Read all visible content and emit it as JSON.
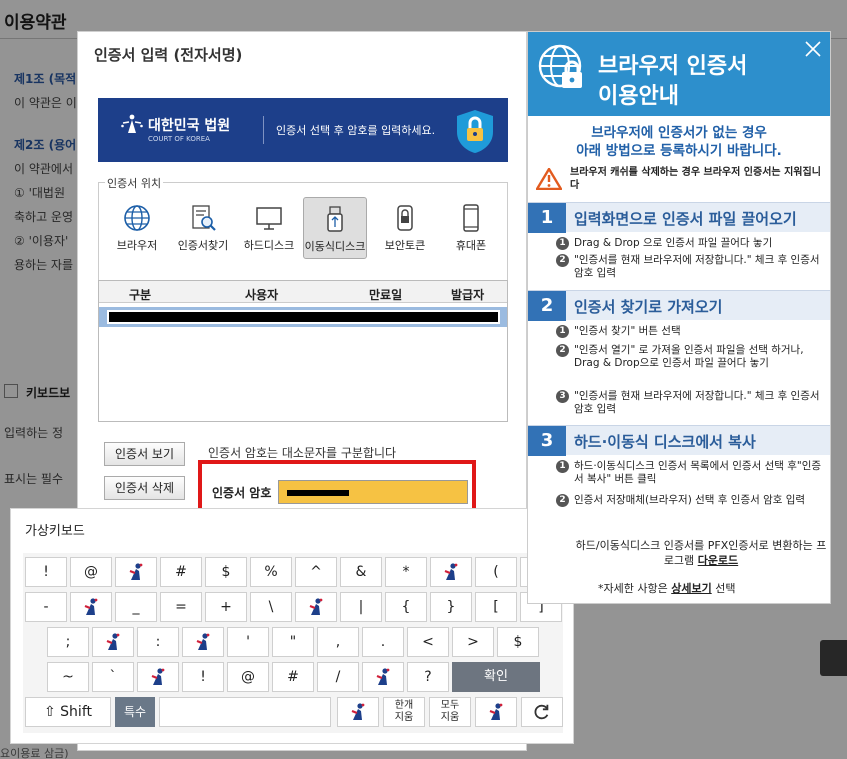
{
  "background": {
    "page_title": "이용약관",
    "line1": "제1조 (목적",
    "line2": "이 약관은 이",
    "line3": "제2조 (용어",
    "line4": "이 약관에서",
    "line5": "① '대법원",
    "line6": "축하고 운영",
    "line7": "② '이용자'",
    "line8": "용하는 자를",
    "keyboard_label": "키보드보",
    "line9": "입력하는 정",
    "line10": "표시는 필수",
    "footer": "요이용료 삼금)"
  },
  "cert_dialog": {
    "title": "인증서 입력 (전자서명)",
    "banner": {
      "court_name": "대한민국 법원",
      "court_en": "COURT OF KOREA",
      "message": "인증서 선택 후 암호를 입력하세요."
    },
    "location_legend": "인증서 위치",
    "locations": [
      {
        "label": "브라우저",
        "icon": "globe-icon"
      },
      {
        "label": "인증서찾기",
        "icon": "cert-search-icon"
      },
      {
        "label": "하드디스크",
        "icon": "monitor-icon"
      },
      {
        "label": "이동식디스크",
        "icon": "usb-icon"
      },
      {
        "label": "보안토큰",
        "icon": "token-icon"
      },
      {
        "label": "휴대폰",
        "icon": "phone-icon"
      }
    ],
    "table_headers": [
      "구분",
      "사용자",
      "만료일",
      "발급자"
    ],
    "view_button": "인증서 보기",
    "delete_button": "인증서 삭제",
    "case_note": "인증서 암호는 대소문자를 구분합니다",
    "password_label": "인증서 암호"
  },
  "keyboard": {
    "title": "가상키보드",
    "row1": [
      "!",
      "@",
      "",
      "#",
      "$",
      "%",
      "^",
      "&",
      "*",
      "",
      "(",
      ")"
    ],
    "row2": [
      "-",
      "",
      "_",
      "=",
      "+",
      "\\",
      "",
      "|",
      "{",
      "}",
      "[",
      "]"
    ],
    "row3": [
      ";",
      "",
      ":",
      "",
      "'",
      "\"",
      ",",
      ".",
      "<",
      ">",
      "$"
    ],
    "row4": [
      "~",
      "`",
      "",
      "!",
      "@",
      "#",
      "/",
      "",
      "?"
    ],
    "confirm": "확인",
    "shift": "⇧ Shift",
    "special": "특수",
    "clear_one_1": "한개",
    "clear_one_2": "지움",
    "clear_all_1": "모두",
    "clear_all_2": "지움"
  },
  "guide": {
    "title_line1": "브라우저 인증서",
    "title_line2": "이용안내",
    "intro_line1": "브라우저에 인증서가 없는 경우",
    "intro_line2": "아래 방법으로 등록하시기 바랍니다.",
    "warning": "브라우저 캐쉬를 삭제하는 경우 브라우저 인증서는 지워집니다",
    "steps": [
      {
        "num": "1",
        "title": "입력화면으로 인증서 파일 끌어오기",
        "items": [
          "Drag & Drop 으로 인증서 파일 끌어다 놓기",
          "\"인증서를 현재 브라우저에 저장합니다.\" 체크 후 인증서 암호 입력"
        ]
      },
      {
        "num": "2",
        "title": "인증서 찾기로 가져오기",
        "items": [
          "\"인증서 찾기\" 버튼 선택",
          "\"인증서 열기\" 로 가져올 인증서 파일을 선택 하거나, Drag & Drop으로 인증서 파일 끌어다 놓기",
          "\"인증서를 현재 브라우저에 저장합니다.\" 체크 후 인증서 암호 입력"
        ]
      },
      {
        "num": "3",
        "title": "하드·이동식 디스크에서 복사",
        "items": [
          "하드·이동식디스크 인증서 목록에서 인증서 선택 후\"인증서 복사\" 버튼 클릭",
          "인증서 저장매체(브라우저) 선택 후 인증서 암호 입력"
        ]
      }
    ],
    "footer_text": "하드/이동식디스크 인증서를 PFX인증서로 변환하는 프로그램",
    "footer_link": "다운로드",
    "more_prefix": "*자세한 사항은",
    "more_link": "상세보기",
    "more_suffix": "선택"
  },
  "colors": {
    "banner": "#1d3f8a",
    "guide_header": "#2d8fcc",
    "step_number": "#3272b6",
    "highlight_frame": "#e01818",
    "password_field": "#f6c243"
  }
}
